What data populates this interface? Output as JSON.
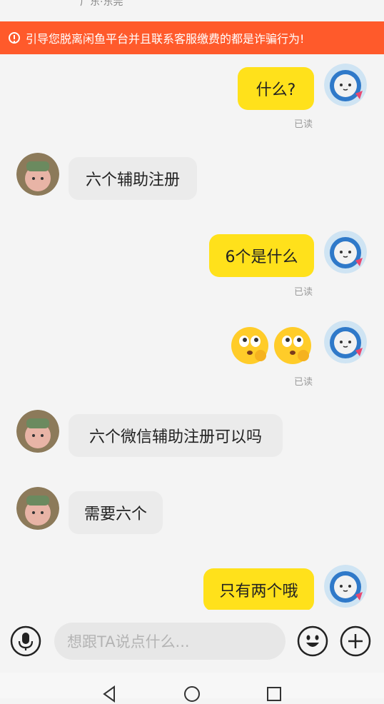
{
  "header": {
    "location": "广东·东莞"
  },
  "warning": {
    "text": "引导您脱离闲鱼平台并且联系客服缴费的都是诈骗行为!"
  },
  "messages": [
    {
      "side": "me",
      "text": "什么?",
      "read": "已读"
    },
    {
      "side": "other",
      "text": "六个辅助注册"
    },
    {
      "side": "me",
      "text": "6个是什么",
      "read": "已读"
    },
    {
      "side": "me",
      "emoji": "thinking-eyes-face-emoji",
      "read": "已读"
    },
    {
      "side": "other",
      "text": "六个微信辅助注册可以吗"
    },
    {
      "side": "other",
      "text": "需要六个"
    },
    {
      "side": "me",
      "text": "只有两个哦"
    }
  ],
  "composer": {
    "placeholder": "想跟TA说点什么...",
    "icons": [
      "microphone-icon",
      "emoji-icon",
      "plus-icon"
    ]
  },
  "nav": {
    "icons": [
      "back-triangle-icon",
      "home-circle-icon",
      "recents-square-icon"
    ]
  },
  "colors": {
    "my_bubble": "#ffe11b",
    "other_bubble": "#ebebeb",
    "warning_bg": "#ff5a2b"
  }
}
